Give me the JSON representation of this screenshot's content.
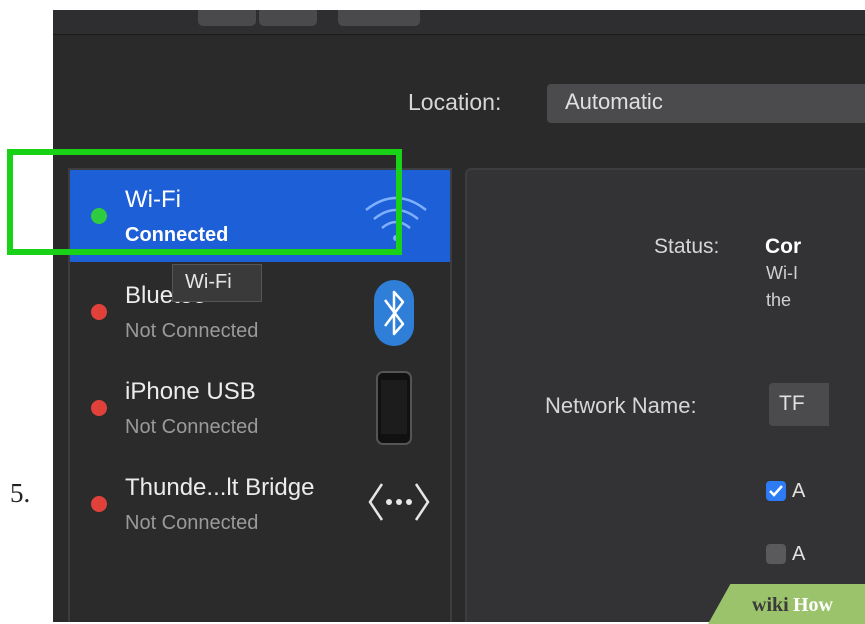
{
  "step_number": "5.",
  "location": {
    "label": "Location:",
    "value": "Automatic"
  },
  "services": [
    {
      "name": "Wi-Fi",
      "status": "Connected",
      "dot_color": "#2ecc40",
      "icon": "wifi-icon",
      "selected": true
    },
    {
      "name": "Bluetoo",
      "status": "Not Connected",
      "dot_color": "#e0413a",
      "icon": "bluetooth-icon"
    },
    {
      "name": "iPhone USB",
      "status": "Not Connected",
      "dot_color": "#e0413a",
      "icon": "iphone-icon"
    },
    {
      "name": "Thunde...lt Bridge",
      "status": "Not Connected",
      "dot_color": "#e0413a",
      "icon": "thunderbolt-bridge-icon"
    }
  ],
  "tooltip": "Wi-Fi",
  "detail": {
    "status_label": "Status:",
    "status_value": "Cor",
    "status_desc_line1": "Wi-I",
    "status_desc_line2": "the",
    "network_name_label": "Network Name:",
    "network_name_value": "TF",
    "checkbox1_label": "A",
    "checkbox2_label": "A"
  },
  "watermark": {
    "part1": "wiki",
    "part2": "How"
  },
  "colors": {
    "highlight": "#19d218",
    "selected_row": "#1d5fd6",
    "checkbox_accent": "#2d7cf6"
  }
}
